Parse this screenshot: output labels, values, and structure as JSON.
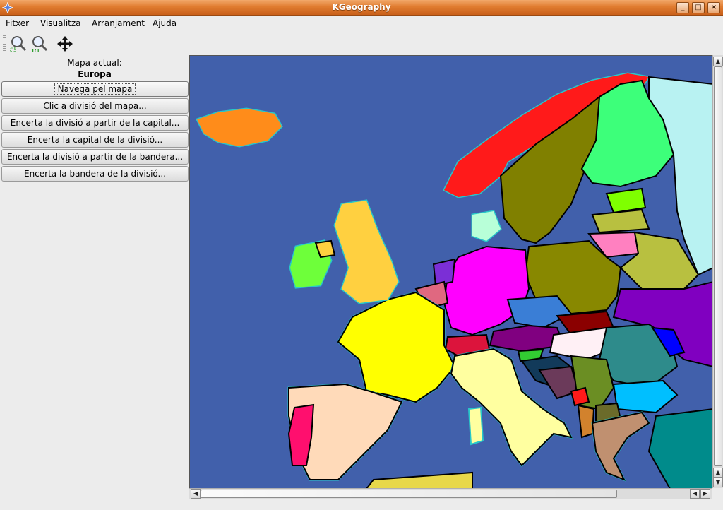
{
  "window": {
    "title": "KGeography",
    "minimize_icon": "minimize-icon",
    "maximize_icon": "maximize-icon",
    "close_icon": "close-icon"
  },
  "menu": [
    "Fitxer",
    "Visualitza",
    "Arranjament",
    "Ajuda"
  ],
  "toolbar": {
    "icons": [
      "zoom-fit-icon",
      "zoom-original-icon",
      "move-icon"
    ]
  },
  "panel": {
    "map_label": "Mapa actual:",
    "map_name": "Europa",
    "buttons": [
      "Navega pel mapa",
      "Clic a divisió del mapa...",
      "Encerta la divisió a partir de la capital...",
      "Encerta la capital de la divisió...",
      "Encerta la divisió a partir de la bandera...",
      "Encerta la bandera de la divisió..."
    ]
  },
  "colors": {
    "sea": "#4160ab",
    "coast": "#28c7c9",
    "titlebar": "#e07c30"
  }
}
